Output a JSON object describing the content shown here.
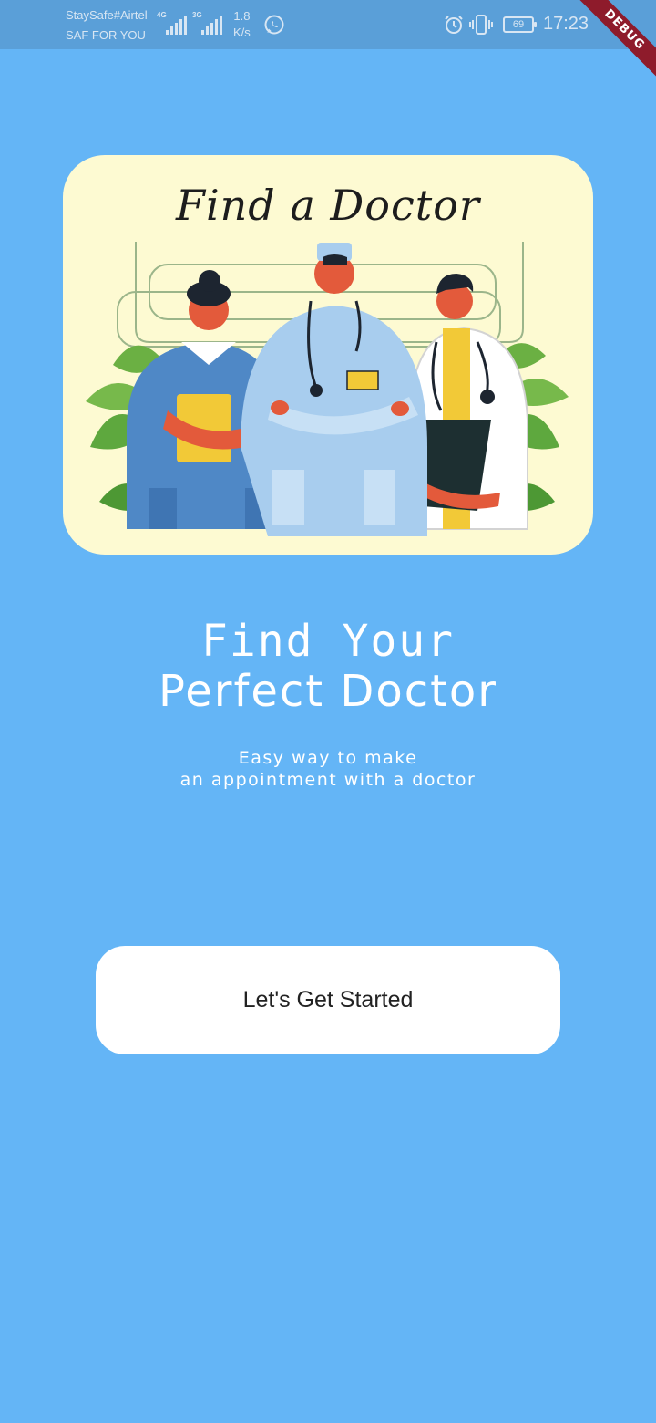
{
  "status_bar": {
    "carrier_line1": "StaySafe#Airtel",
    "carrier_line2": "SAF FOR YOU",
    "network1": "4G",
    "network2": "3G",
    "speed_value": "1.8",
    "speed_unit": "K/s",
    "battery": "69",
    "time": "17:23",
    "debug_label": "DEBUG",
    "icons": [
      "whatsapp-icon",
      "alarm-icon",
      "vibrate-icon",
      "battery-icon"
    ]
  },
  "illustration": {
    "title": "Find a Doctor"
  },
  "headline": {
    "line1": "Find Your",
    "line2": "Perfect Doctor"
  },
  "subtitle": {
    "line1": "Easy way to make",
    "line2": "an appointment with a doctor"
  },
  "cta": {
    "label": "Let's Get Started"
  },
  "colors": {
    "background": "#64b5f6",
    "status_bar": "#5a9fd8",
    "card": "#fdfad2",
    "button": "#ffffff"
  }
}
